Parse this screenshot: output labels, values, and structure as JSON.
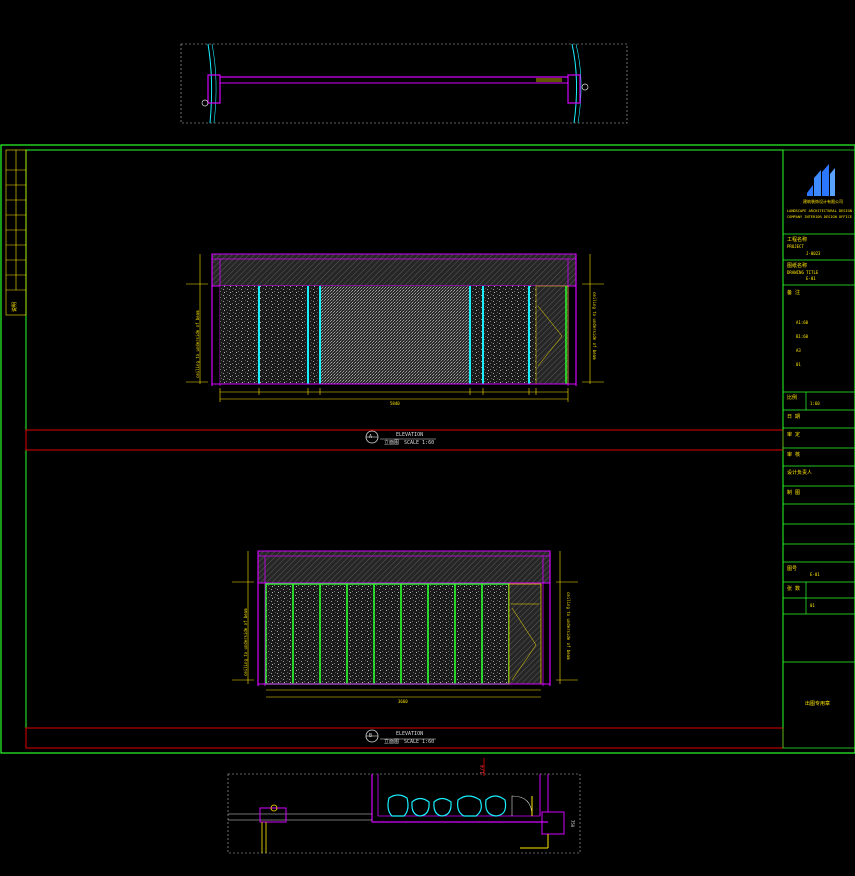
{
  "colors": {
    "background": "#000000",
    "frame_green": "#2aff2a",
    "frame_magenta": "#d400ff",
    "wall_cyan": "#19f0ff",
    "dim_yellow": "#ffe600",
    "band_red": "#e00000",
    "logo_blue": "#2b77ff"
  },
  "elevation_a": {
    "marker": "A",
    "label": "ELEVATION",
    "scale": "SCALE 1:60",
    "zh": "立面图",
    "overall_dim": "5840",
    "right_note": "ceiling to underside of beam",
    "left_note": "ceiling to underside of beam"
  },
  "elevation_b": {
    "marker": "B",
    "label": "ELEVATION",
    "scale": "SCALE 1:60",
    "zh": "立面图",
    "overall_dim": "3660",
    "left_note": "ceiling to underside of beam",
    "right_note": "ceiling to underside of beam"
  },
  "plan_bottom": {
    "tag": "1/4",
    "dim": "750"
  },
  "title_block": {
    "company_en_1": "LANDSCAPE ARCHITECTURAL DESIGN",
    "company_en_2": "COMPANY INTERIOR DESIGN OFFICE",
    "company_cn": "建筑装饰设计有限公司",
    "project_label": "工程名称",
    "project_value": "PROJECT",
    "project_code": "J-0023",
    "drawing_label": "图纸名称",
    "drawing_value": "DRAWING TITLE",
    "drawing_code": "E-01",
    "notes_label": "备 注",
    "notes_items": [
      "A1:60",
      "B1:60",
      "A3",
      "01"
    ],
    "scale_label": "比例",
    "scale_value": "1:60",
    "date_label": "日 期",
    "approved_label": "审 定",
    "checked_label": "审 核",
    "design_label": "设计负责人",
    "drafter_label": "制 图",
    "drawing_no_label": "图号",
    "drawing_no_value": "E-01",
    "sheet_label": "张 数",
    "sheet_value": "01",
    "stamp_text": "出图专用章"
  },
  "left_strip": {
    "bottom_text": "说明"
  }
}
